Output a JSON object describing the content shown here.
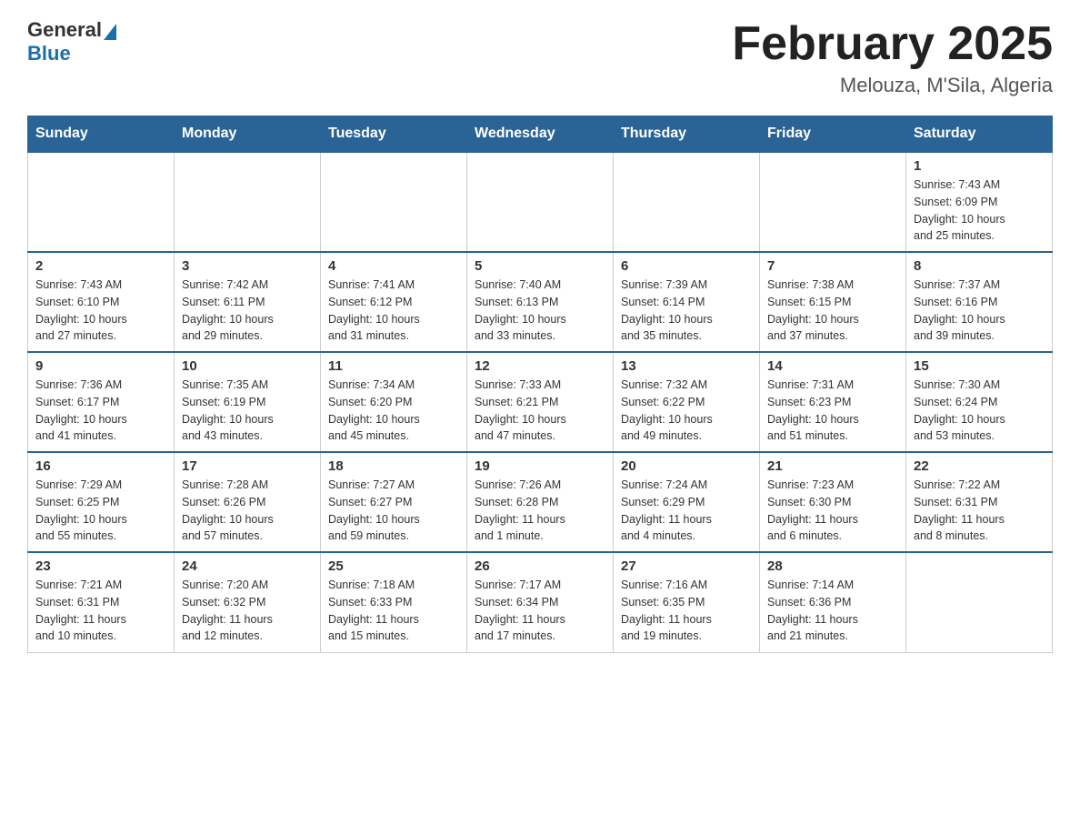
{
  "header": {
    "logo_general": "General",
    "logo_blue": "Blue",
    "month_title": "February 2025",
    "location": "Melouza, M'Sila, Algeria"
  },
  "weekdays": [
    "Sunday",
    "Monday",
    "Tuesday",
    "Wednesday",
    "Thursday",
    "Friday",
    "Saturday"
  ],
  "weeks": [
    [
      {
        "day": "",
        "info": ""
      },
      {
        "day": "",
        "info": ""
      },
      {
        "day": "",
        "info": ""
      },
      {
        "day": "",
        "info": ""
      },
      {
        "day": "",
        "info": ""
      },
      {
        "day": "",
        "info": ""
      },
      {
        "day": "1",
        "info": "Sunrise: 7:43 AM\nSunset: 6:09 PM\nDaylight: 10 hours\nand 25 minutes."
      }
    ],
    [
      {
        "day": "2",
        "info": "Sunrise: 7:43 AM\nSunset: 6:10 PM\nDaylight: 10 hours\nand 27 minutes."
      },
      {
        "day": "3",
        "info": "Sunrise: 7:42 AM\nSunset: 6:11 PM\nDaylight: 10 hours\nand 29 minutes."
      },
      {
        "day": "4",
        "info": "Sunrise: 7:41 AM\nSunset: 6:12 PM\nDaylight: 10 hours\nand 31 minutes."
      },
      {
        "day": "5",
        "info": "Sunrise: 7:40 AM\nSunset: 6:13 PM\nDaylight: 10 hours\nand 33 minutes."
      },
      {
        "day": "6",
        "info": "Sunrise: 7:39 AM\nSunset: 6:14 PM\nDaylight: 10 hours\nand 35 minutes."
      },
      {
        "day": "7",
        "info": "Sunrise: 7:38 AM\nSunset: 6:15 PM\nDaylight: 10 hours\nand 37 minutes."
      },
      {
        "day": "8",
        "info": "Sunrise: 7:37 AM\nSunset: 6:16 PM\nDaylight: 10 hours\nand 39 minutes."
      }
    ],
    [
      {
        "day": "9",
        "info": "Sunrise: 7:36 AM\nSunset: 6:17 PM\nDaylight: 10 hours\nand 41 minutes."
      },
      {
        "day": "10",
        "info": "Sunrise: 7:35 AM\nSunset: 6:19 PM\nDaylight: 10 hours\nand 43 minutes."
      },
      {
        "day": "11",
        "info": "Sunrise: 7:34 AM\nSunset: 6:20 PM\nDaylight: 10 hours\nand 45 minutes."
      },
      {
        "day": "12",
        "info": "Sunrise: 7:33 AM\nSunset: 6:21 PM\nDaylight: 10 hours\nand 47 minutes."
      },
      {
        "day": "13",
        "info": "Sunrise: 7:32 AM\nSunset: 6:22 PM\nDaylight: 10 hours\nand 49 minutes."
      },
      {
        "day": "14",
        "info": "Sunrise: 7:31 AM\nSunset: 6:23 PM\nDaylight: 10 hours\nand 51 minutes."
      },
      {
        "day": "15",
        "info": "Sunrise: 7:30 AM\nSunset: 6:24 PM\nDaylight: 10 hours\nand 53 minutes."
      }
    ],
    [
      {
        "day": "16",
        "info": "Sunrise: 7:29 AM\nSunset: 6:25 PM\nDaylight: 10 hours\nand 55 minutes."
      },
      {
        "day": "17",
        "info": "Sunrise: 7:28 AM\nSunset: 6:26 PM\nDaylight: 10 hours\nand 57 minutes."
      },
      {
        "day": "18",
        "info": "Sunrise: 7:27 AM\nSunset: 6:27 PM\nDaylight: 10 hours\nand 59 minutes."
      },
      {
        "day": "19",
        "info": "Sunrise: 7:26 AM\nSunset: 6:28 PM\nDaylight: 11 hours\nand 1 minute."
      },
      {
        "day": "20",
        "info": "Sunrise: 7:24 AM\nSunset: 6:29 PM\nDaylight: 11 hours\nand 4 minutes."
      },
      {
        "day": "21",
        "info": "Sunrise: 7:23 AM\nSunset: 6:30 PM\nDaylight: 11 hours\nand 6 minutes."
      },
      {
        "day": "22",
        "info": "Sunrise: 7:22 AM\nSunset: 6:31 PM\nDaylight: 11 hours\nand 8 minutes."
      }
    ],
    [
      {
        "day": "23",
        "info": "Sunrise: 7:21 AM\nSunset: 6:31 PM\nDaylight: 11 hours\nand 10 minutes."
      },
      {
        "day": "24",
        "info": "Sunrise: 7:20 AM\nSunset: 6:32 PM\nDaylight: 11 hours\nand 12 minutes."
      },
      {
        "day": "25",
        "info": "Sunrise: 7:18 AM\nSunset: 6:33 PM\nDaylight: 11 hours\nand 15 minutes."
      },
      {
        "day": "26",
        "info": "Sunrise: 7:17 AM\nSunset: 6:34 PM\nDaylight: 11 hours\nand 17 minutes."
      },
      {
        "day": "27",
        "info": "Sunrise: 7:16 AM\nSunset: 6:35 PM\nDaylight: 11 hours\nand 19 minutes."
      },
      {
        "day": "28",
        "info": "Sunrise: 7:14 AM\nSunset: 6:36 PM\nDaylight: 11 hours\nand 21 minutes."
      },
      {
        "day": "",
        "info": ""
      }
    ]
  ]
}
